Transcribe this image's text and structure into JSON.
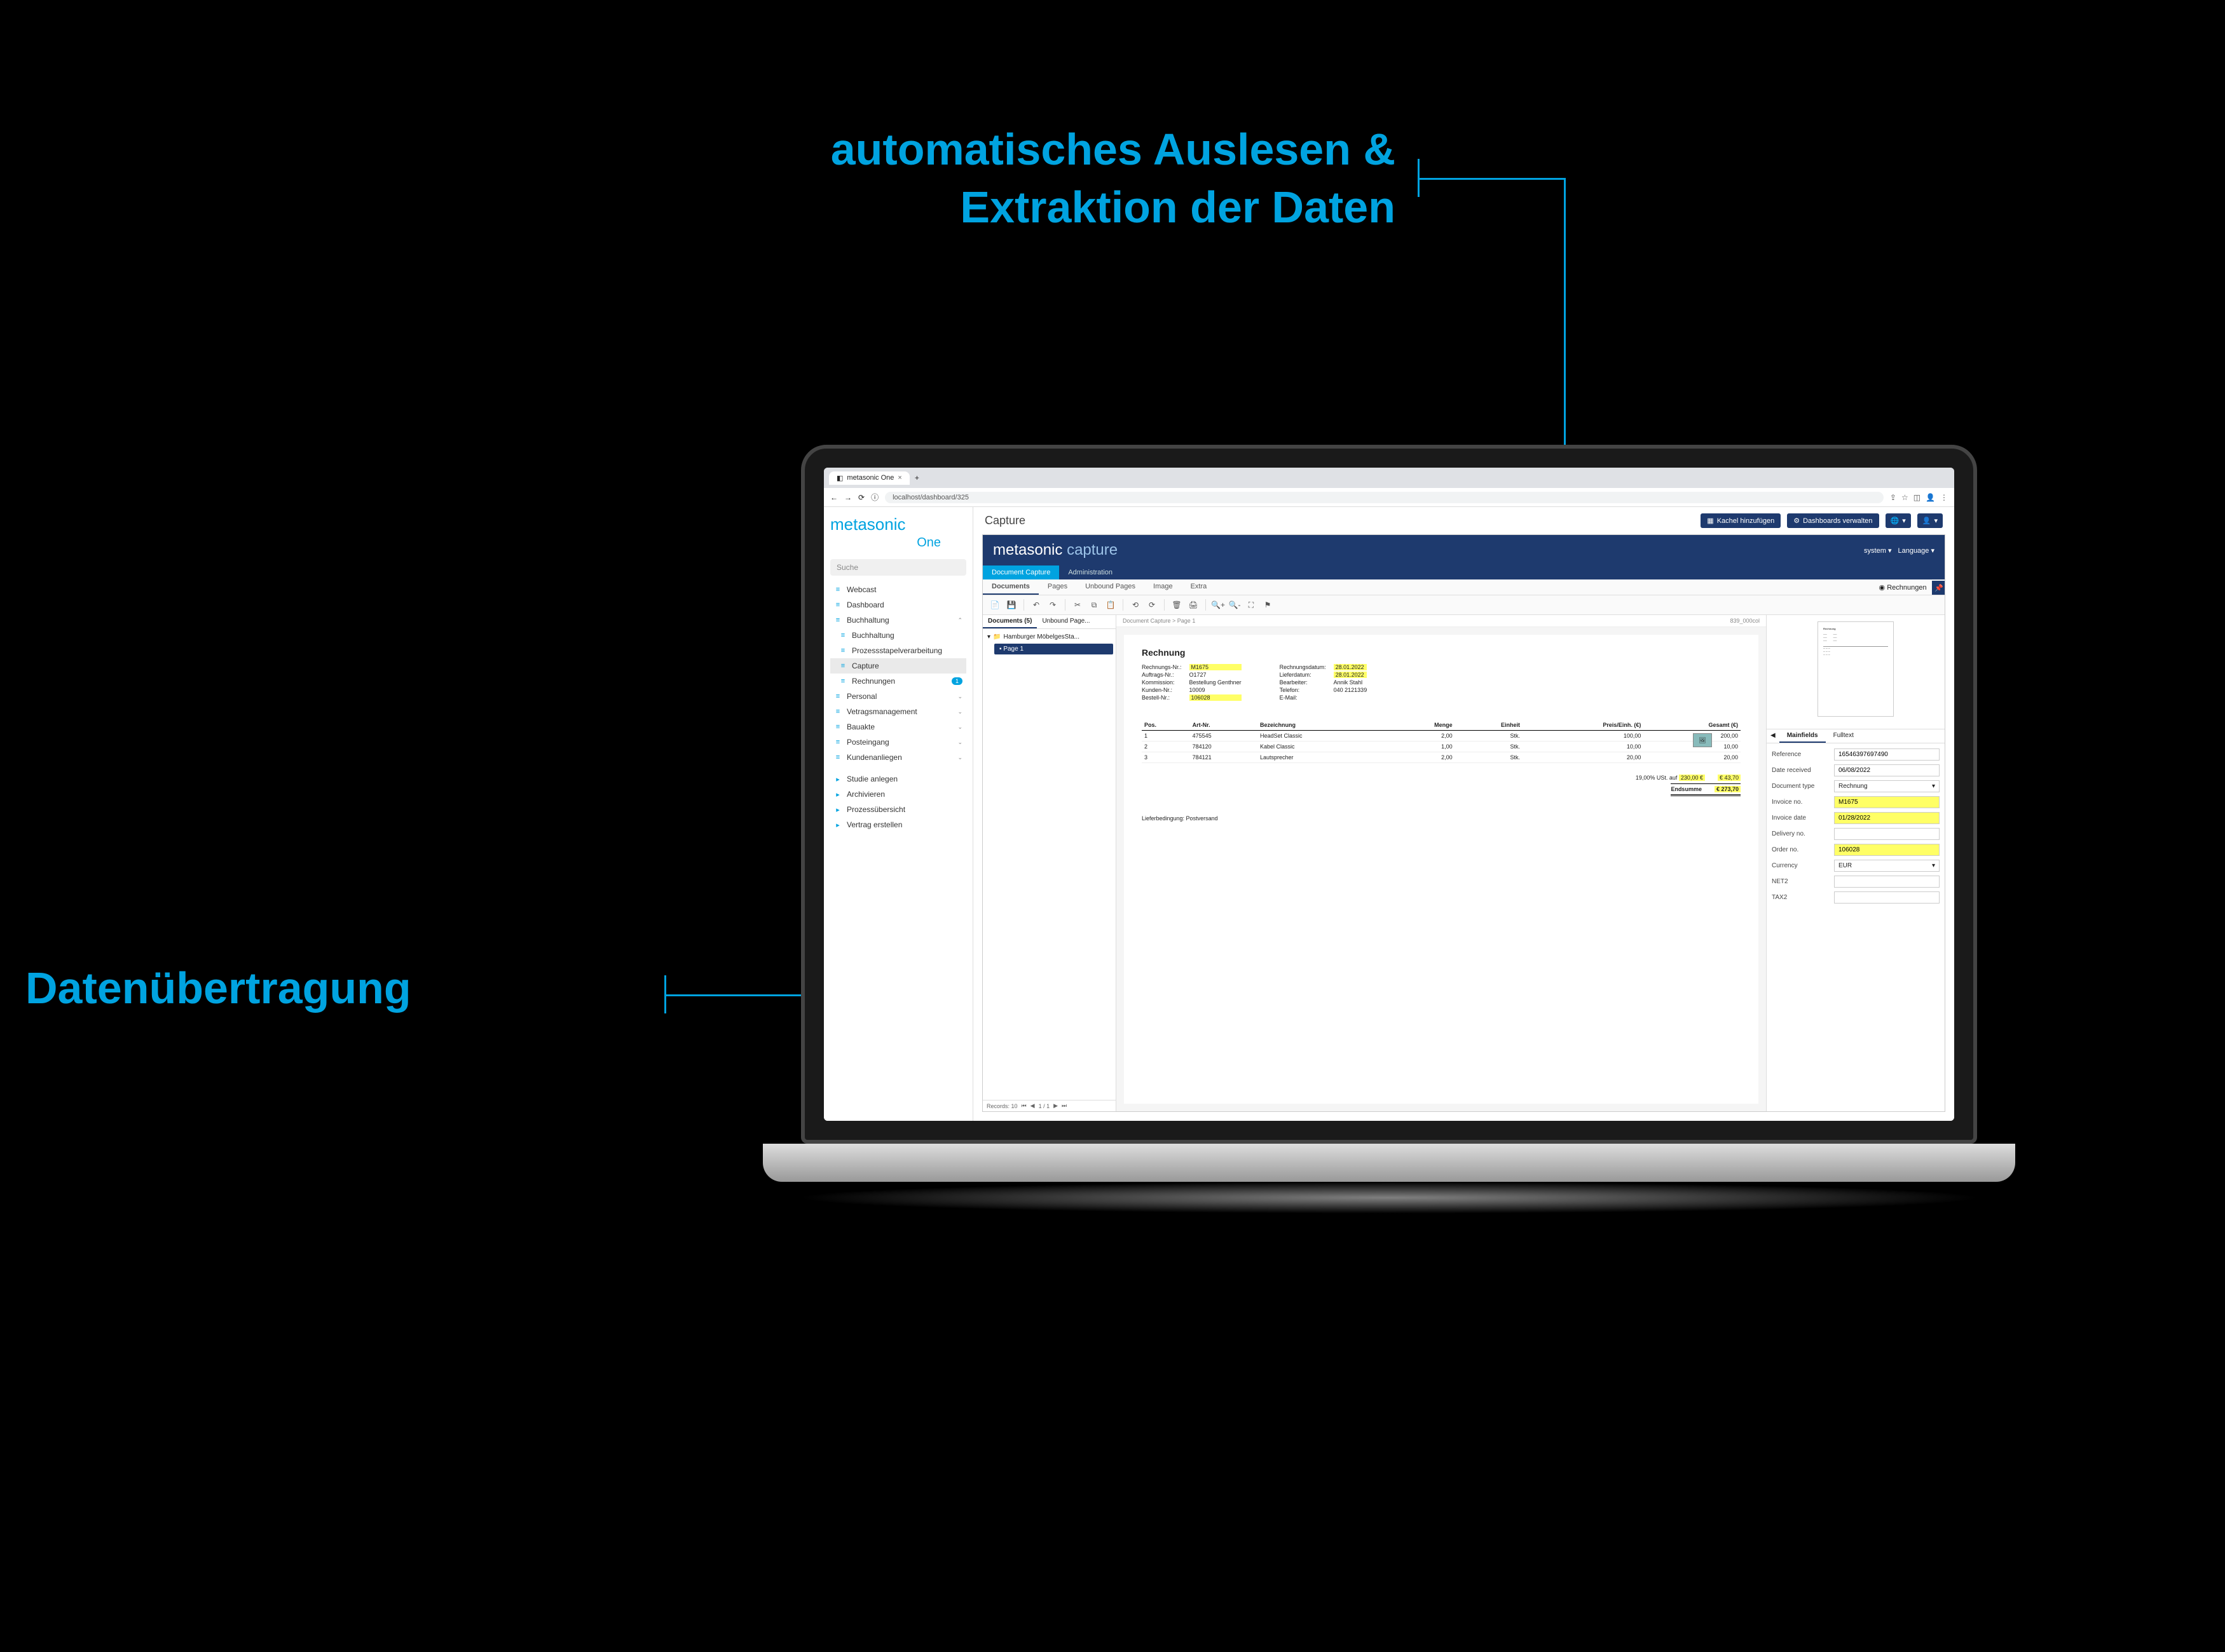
{
  "annotations": {
    "top_line1": "automatisches Auslesen &",
    "top_line2": "Extraktion der Daten",
    "left": "Datenübertragung"
  },
  "chrome": {
    "tab_title": "metasonic One",
    "url": "localhost/dashboard/325",
    "new_tab": "+"
  },
  "brand": {
    "name": "metasonic",
    "sub": "One"
  },
  "search": {
    "placeholder": "Suche"
  },
  "nav": {
    "items": [
      {
        "label": "Webcast"
      },
      {
        "label": "Dashboard"
      },
      {
        "label": "Buchhaltung",
        "chevron": "⌃"
      },
      {
        "label": "Buchhaltung",
        "sub": true
      },
      {
        "label": "Prozessstapelverarbeitung",
        "sub": true
      },
      {
        "label": "Capture",
        "sub": true,
        "active": true
      },
      {
        "label": "Rechnungen",
        "sub": true,
        "badge": "1"
      },
      {
        "label": "Personal",
        "chevron": "⌄"
      },
      {
        "label": "Vetragsmanagement",
        "chevron": "⌄"
      },
      {
        "label": "Bauakte",
        "chevron": "⌄"
      },
      {
        "label": "Posteingang",
        "chevron": "⌄"
      },
      {
        "label": "Kundenanliegen",
        "chevron": "⌄"
      }
    ],
    "actions": [
      {
        "label": "Studie anlegen"
      },
      {
        "label": "Archivieren"
      },
      {
        "label": "Prozessübersicht"
      },
      {
        "label": "Vertrag erstellen"
      }
    ]
  },
  "topbar": {
    "title": "Capture",
    "btn_add": "Kachel hinzufügen",
    "btn_manage": "Dashboards verwalten"
  },
  "capture": {
    "brand": "metasonic",
    "brand2": "capture",
    "menu_sys": "system",
    "menu_lang": "Language",
    "nav": [
      {
        "label": "Document Capture",
        "active": true
      },
      {
        "label": "Administration"
      }
    ],
    "subtabs": [
      {
        "label": "Documents",
        "active": true
      },
      {
        "label": "Pages"
      },
      {
        "label": "Unbound Pages"
      },
      {
        "label": "Image"
      },
      {
        "label": "Extra"
      }
    ],
    "subtab_r": "Rechnungen",
    "tree_tabs": [
      {
        "label": "Documents (5)",
        "active": true
      },
      {
        "label": "Unbound Page..."
      }
    ],
    "folder": "Hamburger MöbelgesSta...",
    "page": "Page 1",
    "tree_footer": {
      "records": "Records: 10",
      "pager": "1 / 1"
    },
    "breadcrumb": "Document Capture > Page 1",
    "zoom": "839_000col"
  },
  "invoice": {
    "title": "Rechnung",
    "left": {
      "Rechnungs-Nr.:": {
        "v": "M1675",
        "hl": true
      },
      "Auftrags-Nr.:": {
        "v": "O1727"
      },
      "Kommission:": {
        "v": "Bestellung Genthner"
      },
      "Kunden-Nr.:": {
        "v": "10009"
      },
      "Bestell-Nr.:": {
        "v": "106028",
        "hl": true
      }
    },
    "right": {
      "Rechnungsdatum:": {
        "v": "28.01.2022",
        "hl": true
      },
      "Lieferdatum:": {
        "v": "28.01.2022",
        "hl": true
      },
      "Bearbeiter:": {
        "v": "Annik Stahl"
      },
      "Telefon:": {
        "v": "040 2121339"
      },
      "E-Mail:": {
        "v": ""
      }
    },
    "cols": [
      "Pos.",
      "Art-Nr.",
      "Bezeichnung",
      "Menge",
      "Einheit",
      "Preis/Einh. (€)",
      "Gesamt (€)"
    ],
    "rows": [
      {
        "pos": "1",
        "art": "475545",
        "desc": "HeadSet Classic",
        "menge": "2,00",
        "einh": "Stk.",
        "preis": "100,00",
        "ges": "200,00"
      },
      {
        "pos": "2",
        "art": "784120",
        "desc": "Kabel Classic",
        "menge": "1,00",
        "einh": "Stk.",
        "preis": "10,00",
        "ges": "10,00"
      },
      {
        "pos": "3",
        "art": "784121",
        "desc": "Lautsprecher",
        "menge": "2,00",
        "einh": "Stk.",
        "preis": "20,00",
        "ges": "20,00"
      }
    ],
    "tax_label": "19,00% USt. auf",
    "tax_base": "230,00 €",
    "tax_amt": "€ 43,70",
    "total_label": "Endsumme",
    "total": "€ 273,70",
    "delivery": "Lieferbedingung: Postversand"
  },
  "fieldtabs": [
    {
      "label": "Mainfields",
      "active": true
    },
    {
      "label": "Fulltext"
    }
  ],
  "fields": [
    {
      "label": "Reference",
      "value": "16546397697490"
    },
    {
      "label": "Date received",
      "value": "06/08/2022"
    },
    {
      "label": "Document type",
      "value": "Rechnung",
      "select": true
    },
    {
      "label": "Invoice no.",
      "value": "M1675",
      "hl": true
    },
    {
      "label": "Invoice date",
      "value": "01/28/2022",
      "hl": true
    },
    {
      "label": "Delivery no.",
      "value": ""
    },
    {
      "label": "Order no.",
      "value": "106028",
      "hl": true
    },
    {
      "label": "Currency",
      "value": "EUR",
      "select": true
    },
    {
      "label": "NET2",
      "value": ""
    },
    {
      "label": "TAX2",
      "value": ""
    }
  ]
}
